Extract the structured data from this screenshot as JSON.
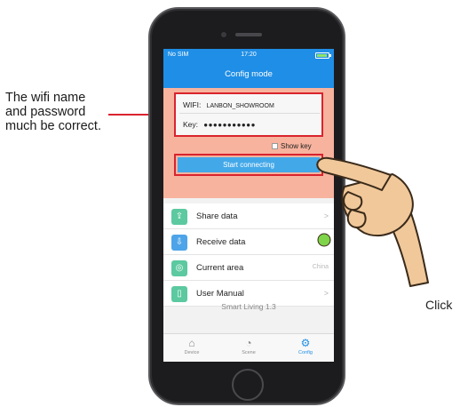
{
  "annotation": {
    "lines": [
      "The wifi name",
      "and password",
      "much be correct."
    ],
    "click_label": "Click"
  },
  "status_bar": {
    "carrier": "No SIM",
    "time": "17:20"
  },
  "nav": {
    "title": "Config mode"
  },
  "config": {
    "wifi_label": "WIFI:",
    "wifi_value": "LANBON_SHOWROOM",
    "key_label": "Key:",
    "key_value": "●●●●●●●●●●●",
    "show_key_label": "Show key",
    "show_key_checked": false,
    "connect_label": "Start connecting"
  },
  "menu": {
    "items": [
      {
        "label": "Share data",
        "icon": "upload-icon",
        "color": "#5cc9a0"
      },
      {
        "label": "Receive data",
        "icon": "download-icon",
        "color": "#4ea4e8"
      },
      {
        "label": "Current area",
        "icon": "globe-icon",
        "color": "#5cc9a0",
        "value": "China"
      },
      {
        "label": "User Manual",
        "icon": "book-icon",
        "color": "#5cc9a0"
      }
    ]
  },
  "version": "Smart Living 1.3",
  "tabs": [
    {
      "label": "Device",
      "icon": "home-icon",
      "active": false
    },
    {
      "label": "Scene",
      "icon": "scene-icon",
      "active": false
    },
    {
      "label": "Config",
      "icon": "gear-icon",
      "active": true
    }
  ],
  "colors": {
    "accent": "#1f8ee6",
    "highlight": "#d9232e",
    "panel": "#f7b39e"
  }
}
